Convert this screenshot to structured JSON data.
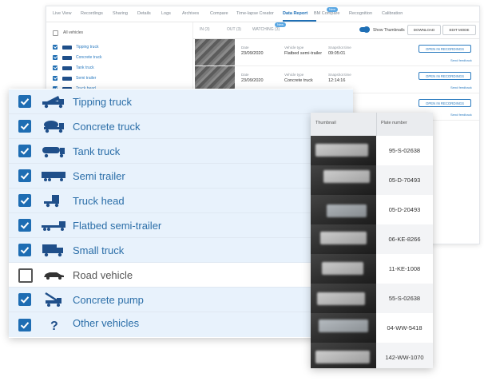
{
  "nav": {
    "items": [
      "Live View",
      "Recordings",
      "Sharing",
      "Details",
      "Logs",
      "Archives",
      "Compare",
      "Time-lapse Creator",
      "Data Report",
      "BM Compare",
      "Recognition",
      "Calibration"
    ],
    "new_badge": "New"
  },
  "sidebar": {
    "all_label": "All vehicles",
    "items": [
      "Tipping truck",
      "Concrete truck",
      "Tank truck",
      "Semi trailer",
      "Truck head"
    ]
  },
  "tabs": [
    "IN (3)",
    "OUT (3)",
    "WATCHING (3)"
  ],
  "watching_badge": "New",
  "toolbar": {
    "show_thumbnails": "Show Thumbnails",
    "download_label": "DOWNLOAD",
    "edit_mode_label": "EDIT MODE"
  },
  "records": [
    {
      "date_key": "Date",
      "date": "23/09/2020",
      "type_key": "Vehicle type",
      "type": "Flatbed semi-trailer",
      "time_key": "Snapshot time",
      "time": "09:05:01",
      "open": "OPEN IN RECORDINGS",
      "feedback": "Send feedback"
    },
    {
      "date_key": "Date",
      "date": "23/09/2020",
      "type_key": "Vehicle type",
      "type": "Concrete truck",
      "time_key": "Snapshot time",
      "time": "12:14:16",
      "open": "OPEN IN RECORDINGS",
      "feedback": "Send feedback"
    },
    {
      "open": "OPEN IN RECORDINGS",
      "feedback": "Send feedback"
    }
  ],
  "vehicle_list": [
    {
      "label": "Tipping truck",
      "checked": true,
      "icon": "tipping-truck-icon"
    },
    {
      "label": "Concrete truck",
      "checked": true,
      "icon": "concrete-truck-icon"
    },
    {
      "label": "Tank truck",
      "checked": true,
      "icon": "tank-truck-icon"
    },
    {
      "label": "Semi trailer",
      "checked": true,
      "icon": "semi-trailer-icon"
    },
    {
      "label": "Truck head",
      "checked": true,
      "icon": "truck-head-icon"
    },
    {
      "label": "Flatbed semi-trailer",
      "checked": true,
      "icon": "flatbed-semi-trailer-icon"
    },
    {
      "label": "Small truck",
      "checked": true,
      "icon": "small-truck-icon"
    },
    {
      "label": "Road vehicle",
      "checked": false,
      "icon": "car-icon"
    },
    {
      "label": "Concrete pump",
      "checked": true,
      "icon": "concrete-pump-icon"
    },
    {
      "label": "Other vehicles",
      "checked": true,
      "icon": "question-mark-icon"
    }
  ],
  "plates_table": {
    "headers": [
      "Thumbnail",
      "Plate number"
    ],
    "rows": [
      "95-S-02638",
      "05-D-70493",
      "05-D-20493",
      "06-KE-8266",
      "11-KE-1008",
      "55-S-02638",
      "04-WW-5418",
      "142-WW-1070"
    ]
  },
  "colors": {
    "accent": "#1e6db3",
    "label": "#2b6ea8",
    "row_highlight": "#e8f2fc"
  }
}
